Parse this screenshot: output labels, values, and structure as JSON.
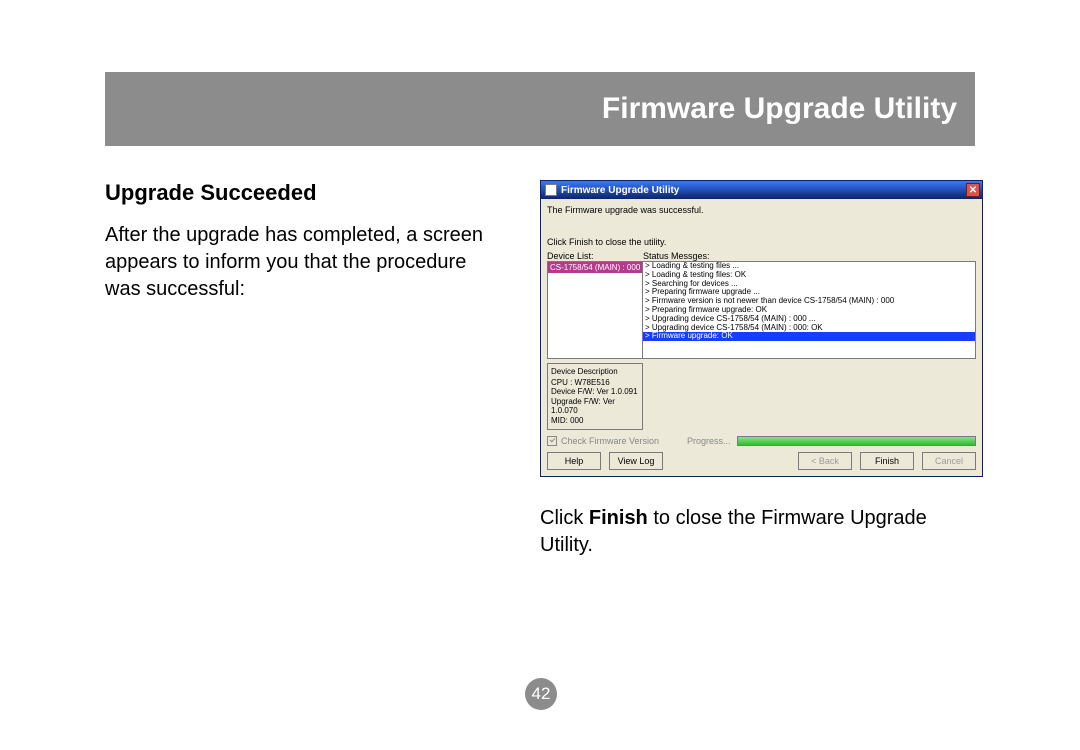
{
  "header": {
    "title": "Firmware Upgrade Utility"
  },
  "left": {
    "heading": "Upgrade Succeeded",
    "paragraph": "After the upgrade has completed, a screen appears to inform you that the procedure was successful:"
  },
  "screenshot": {
    "window_title": "Firmware Upgrade Utility",
    "close_glyph": "✕",
    "msg1": "The Firmware upgrade was successful.",
    "msg2": "Click Finish to close the utility.",
    "device_list_label": "Device List:",
    "status_label": "Status Messges:",
    "device_selected": "CS-1758/54 (MAIN) : 000",
    "status_lines": [
      "> Loading & testing files ...",
      "> Loading & testing files: OK",
      "> Searching for devices ...",
      "> Preparing firmware upgrade ...",
      "> Firmware version is not newer than device CS-1758/54 (MAIN) : 000",
      "> Preparing firmware upgrade: OK",
      "> Upgrading device CS-1758/54 (MAIN) : 000 ...",
      "> Upgrading device CS-1758/54 (MAIN) : 000: OK"
    ],
    "status_last": "> Firmware upgrade: OK",
    "device_desc": {
      "title": "Device Description",
      "cpu": "CPU : W78E516",
      "dfw": "Device F/W: Ver 1.0.091",
      "ufw": "Upgrade F/W: Ver 1.0.070",
      "mid": "MID: 000"
    },
    "check_label": "Check Firmware Version",
    "progress_label": "Progress...",
    "buttons": {
      "help": "Help",
      "viewlog": "View Log",
      "back": "< Back",
      "finish": "Finish",
      "cancel": "Cancel"
    }
  },
  "caption_pre": "Click ",
  "caption_bold": "Finish",
  "caption_post": " to close the Firmware Upgrade Utility.",
  "page_number": "42"
}
